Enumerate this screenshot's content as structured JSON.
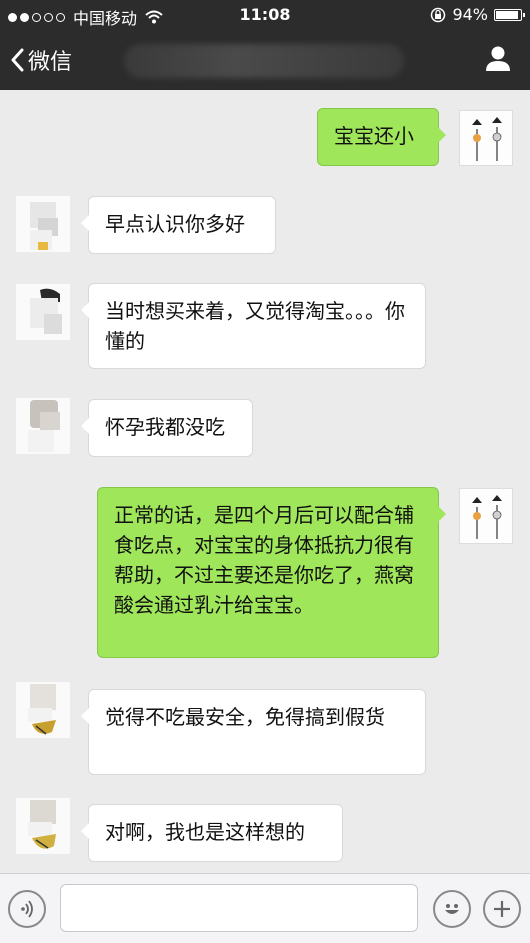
{
  "status_bar": {
    "carrier": "中国移动",
    "time": "11:08",
    "battery": "94%",
    "battery_level": 0.94
  },
  "nav": {
    "back_label": "微信"
  },
  "messages": [
    {
      "side": "right",
      "text": "宝宝还小"
    },
    {
      "side": "left",
      "text": "早点认识你多好"
    },
    {
      "side": "left",
      "text": "当时想买来着，又觉得淘宝。。。你懂的"
    },
    {
      "side": "left",
      "text": "怀孕我都没吃"
    },
    {
      "side": "right",
      "text": "正常的话，是四个月后可以配合辅食吃点，对宝宝的身体抵抗力很有帮助，不过主要还是你吃了，燕窝酸会通过乳汁给宝宝。"
    },
    {
      "side": "left",
      "text": "觉得不吃最安全，免得搞到假货"
    },
    {
      "side": "left",
      "text": "对啊，我也是这样想的"
    }
  ],
  "colors": {
    "sent_bubble": "#9fe65a",
    "received_bubble": "#ffffff",
    "nav_background": "#2c2c2c",
    "chat_background": "#ebebeb"
  },
  "icons": {
    "back": "chevron-left-icon",
    "profile": "person-icon",
    "voice": "voice-icon",
    "emoji": "smiley-icon",
    "more": "plus-icon"
  }
}
